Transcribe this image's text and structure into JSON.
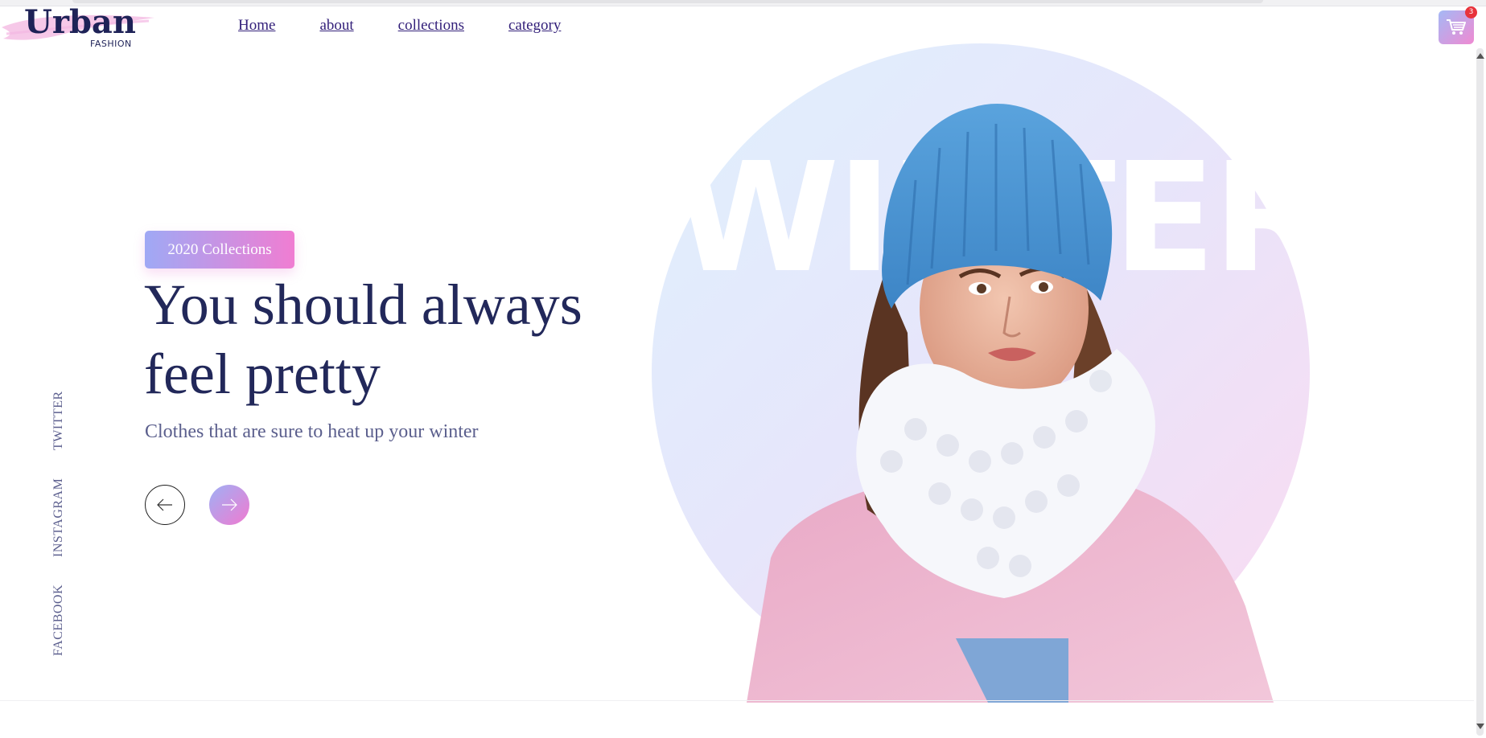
{
  "brand": {
    "name": "Urban",
    "tagline": "FASHION"
  },
  "nav": {
    "items": [
      {
        "label": "Home"
      },
      {
        "label": "about"
      },
      {
        "label": "collections"
      },
      {
        "label": "category"
      }
    ]
  },
  "cart": {
    "count": "3",
    "icon": "shopping-cart-icon"
  },
  "social": {
    "twitter": "TWITTER",
    "instagram": "INSTAGRAM",
    "facebook": "FACEBOOK"
  },
  "hero": {
    "tag": "2020 Collections",
    "headline_line1": "You should always",
    "headline_line2": "feel pretty",
    "subtitle": "Clothes that are sure to heat up your winter",
    "background_word": "WINTER",
    "prev_icon": "arrow-left-icon",
    "next_icon": "arrow-right-icon"
  },
  "colors": {
    "primary_text": "#22285a",
    "nav_link": "#33207a",
    "gradient_start": "#9fa9f5",
    "gradient_end": "#f07dd2",
    "badge": "#e8323c"
  }
}
